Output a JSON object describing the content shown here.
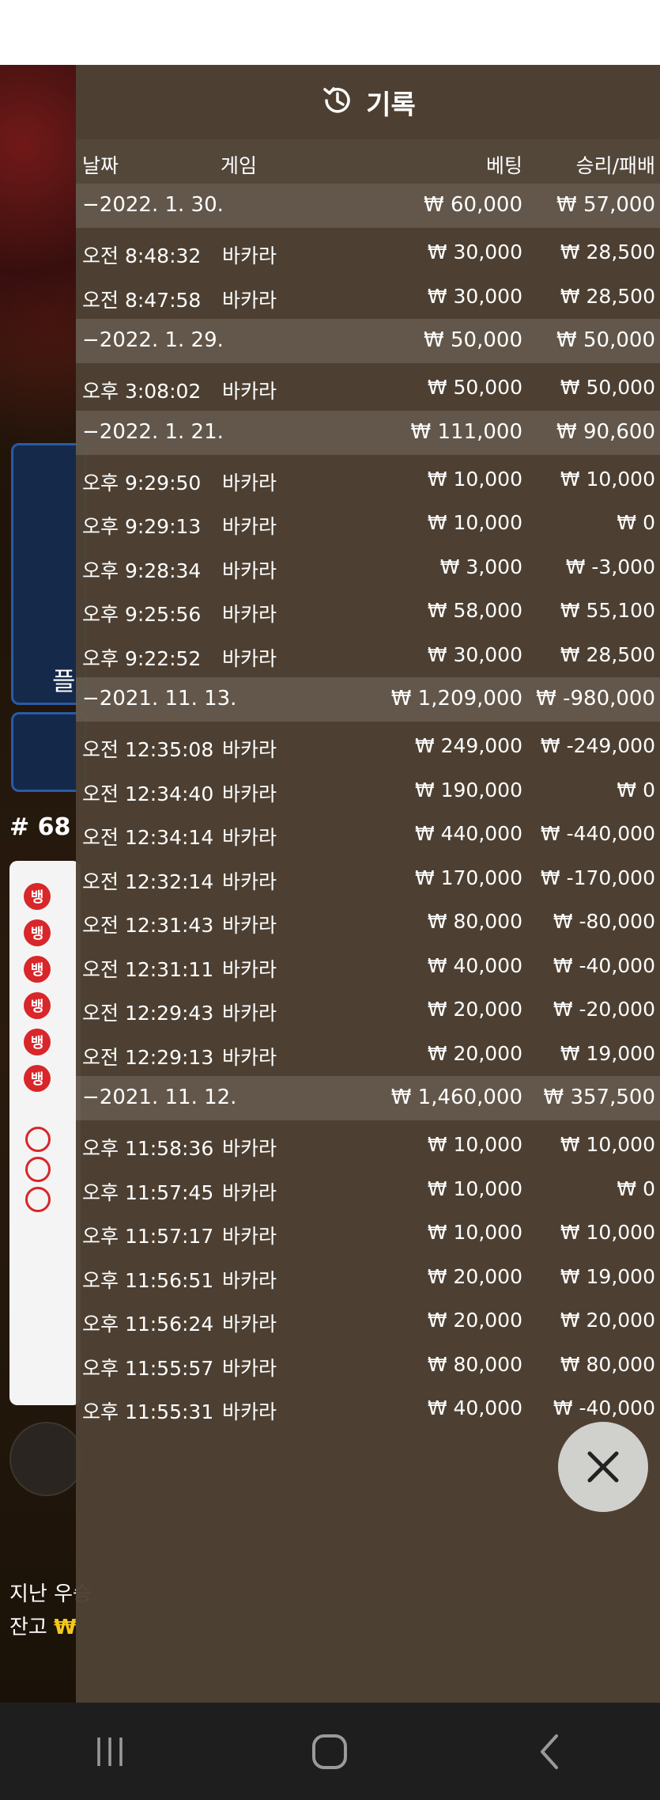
{
  "header": {
    "title": "기록",
    "icon": "history-icon"
  },
  "columns": {
    "date": "날짜",
    "game": "게임",
    "bet": "베팅",
    "result": "승리/패배"
  },
  "groups": [
    {
      "date": "−2022. 1. 30.",
      "bet": "₩ 60,000",
      "result": "₩ 57,000",
      "rows": [
        {
          "time": "오전 8:48:32",
          "game": "바카라",
          "bet": "₩ 30,000",
          "result": "₩ 28,500"
        },
        {
          "time": "오전 8:47:58",
          "game": "바카라",
          "bet": "₩ 30,000",
          "result": "₩ 28,500"
        }
      ]
    },
    {
      "date": "−2022. 1. 29.",
      "bet": "₩ 50,000",
      "result": "₩ 50,000",
      "rows": [
        {
          "time": "오후 3:08:02",
          "game": "바카라",
          "bet": "₩ 50,000",
          "result": "₩ 50,000"
        }
      ]
    },
    {
      "date": "−2022. 1. 21.",
      "bet": "₩ 111,000",
      "result": "₩ 90,600",
      "rows": [
        {
          "time": "오후 9:29:50",
          "game": "바카라",
          "bet": "₩ 10,000",
          "result": "₩ 10,000"
        },
        {
          "time": "오후 9:29:13",
          "game": "바카라",
          "bet": "₩ 10,000",
          "result": "₩ 0"
        },
        {
          "time": "오후 9:28:34",
          "game": "바카라",
          "bet": "₩ 3,000",
          "result": "₩ -3,000"
        },
        {
          "time": "오후 9:25:56",
          "game": "바카라",
          "bet": "₩ 58,000",
          "result": "₩ 55,100"
        },
        {
          "time": "오후 9:22:52",
          "game": "바카라",
          "bet": "₩ 30,000",
          "result": "₩ 28,500"
        }
      ]
    },
    {
      "date": "−2021. 11. 13.",
      "bet": "₩ 1,209,000",
      "result": "₩ -980,000",
      "rows": [
        {
          "time": "오전 12:35:08",
          "game": "바카라",
          "bet": "₩ 249,000",
          "result": "₩ -249,000"
        },
        {
          "time": "오전 12:34:40",
          "game": "바카라",
          "bet": "₩ 190,000",
          "result": "₩ 0"
        },
        {
          "time": "오전 12:34:14",
          "game": "바카라",
          "bet": "₩ 440,000",
          "result": "₩ -440,000"
        },
        {
          "time": "오전 12:32:14",
          "game": "바카라",
          "bet": "₩ 170,000",
          "result": "₩ -170,000"
        },
        {
          "time": "오전 12:31:43",
          "game": "바카라",
          "bet": "₩ 80,000",
          "result": "₩ -80,000"
        },
        {
          "time": "오전 12:31:11",
          "game": "바카라",
          "bet": "₩ 40,000",
          "result": "₩ -40,000"
        },
        {
          "time": "오전 12:29:43",
          "game": "바카라",
          "bet": "₩ 20,000",
          "result": "₩ -20,000"
        },
        {
          "time": "오전 12:29:13",
          "game": "바카라",
          "bet": "₩ 20,000",
          "result": "₩ 19,000"
        }
      ]
    },
    {
      "date": "−2021. 11. 12.",
      "bet": "₩ 1,460,000",
      "result": "₩ 357,500",
      "rows": [
        {
          "time": "오후 11:58:36",
          "game": "바카라",
          "bet": "₩ 10,000",
          "result": "₩ 10,000"
        },
        {
          "time": "오후 11:57:45",
          "game": "바카라",
          "bet": "₩ 10,000",
          "result": "₩ 0"
        },
        {
          "time": "오후 11:57:17",
          "game": "바카라",
          "bet": "₩ 10,000",
          "result": "₩ 10,000"
        },
        {
          "time": "오후 11:56:51",
          "game": "바카라",
          "bet": "₩ 20,000",
          "result": "₩ 19,000"
        },
        {
          "time": "오후 11:56:24",
          "game": "바카라",
          "bet": "₩ 20,000",
          "result": "₩ 20,000"
        },
        {
          "time": "오후 11:55:57",
          "game": "바카라",
          "bet": "₩ 80,000",
          "result": "₩ 80,000"
        },
        {
          "time": "오후 11:55:31",
          "game": "바카라",
          "bet": "₩ 40,000",
          "result": "₩ -40,000"
        }
      ]
    }
  ],
  "background": {
    "side_label": "플",
    "round_label": "# 68",
    "road_label": "뱅",
    "last_win_label": "지난 우승",
    "balance_label": "잔고",
    "balance_value": "₩"
  },
  "close_icon": "close-icon",
  "nav": {
    "recents": "recents-icon",
    "home": "home-icon",
    "back": "back-icon"
  }
}
